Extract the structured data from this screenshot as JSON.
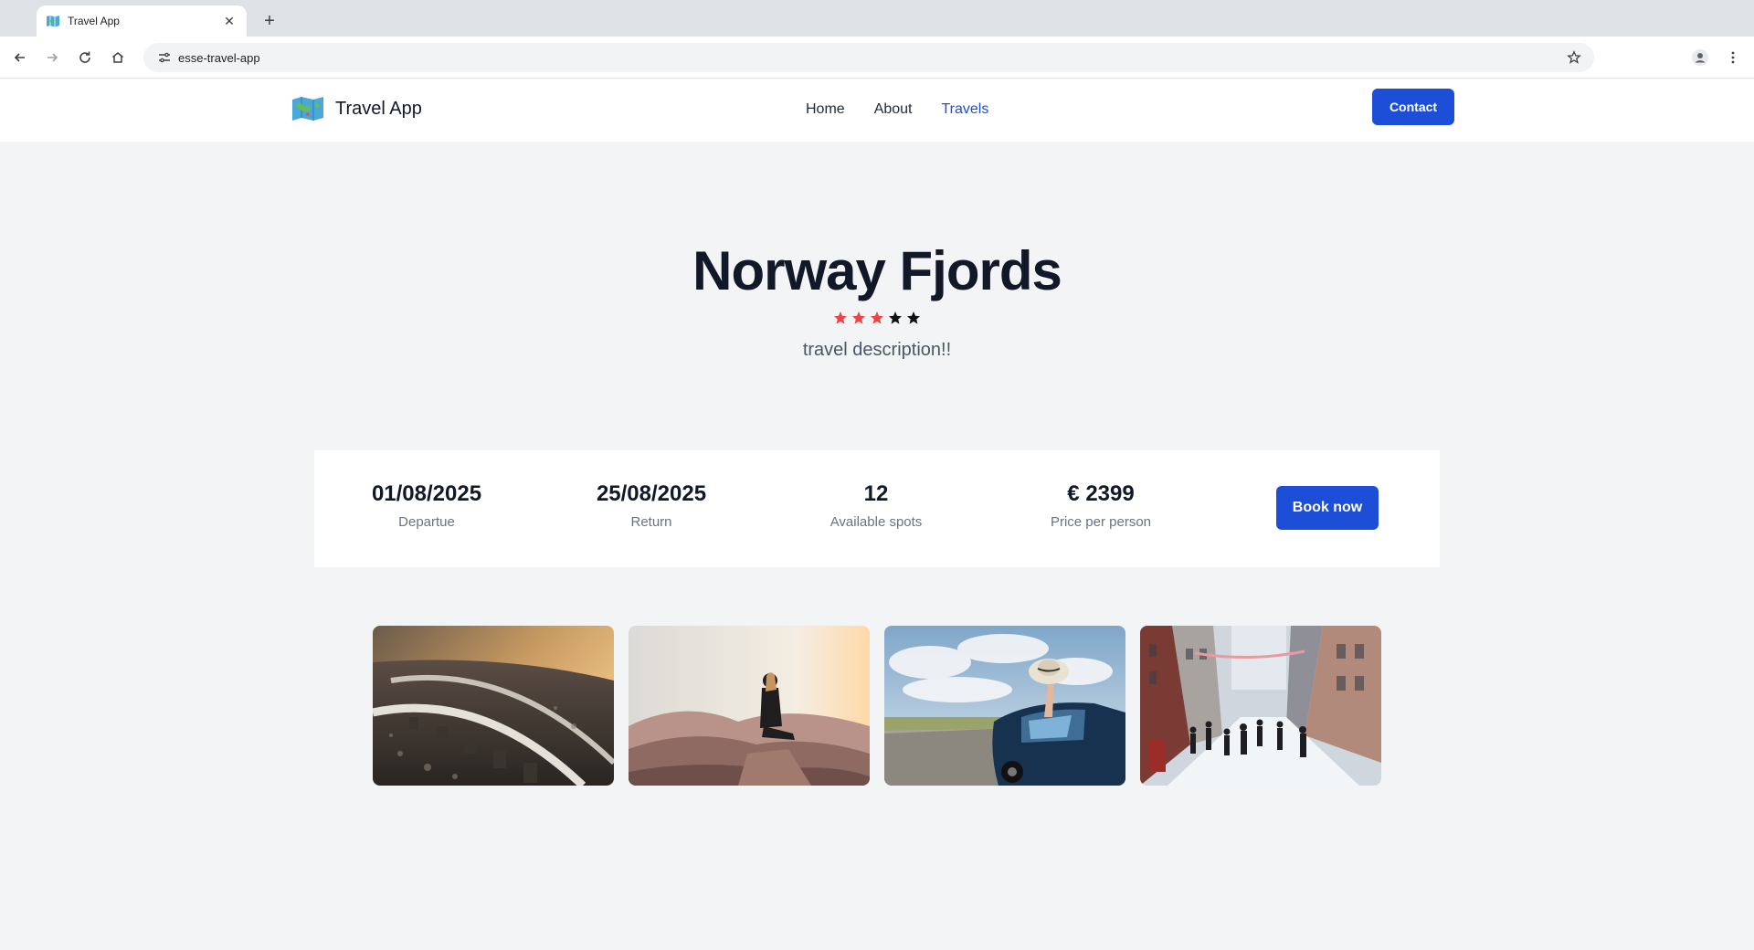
{
  "browser": {
    "tab": {
      "title": "Travel App",
      "favicon": "map-icon",
      "close_icon": "close-icon"
    },
    "new_tab_icon": "plus-icon",
    "toolbar": {
      "back_icon": "arrow-left-icon",
      "forward_icon": "arrow-right-icon",
      "reload_icon": "reload-icon",
      "home_icon": "home-icon",
      "site_info_icon": "tune-icon",
      "url": "esse-travel-app",
      "bookmark_icon": "star-outline-icon",
      "profile_icon": "account-icon",
      "menu_icon": "kebab-menu-icon"
    }
  },
  "header": {
    "brand": {
      "name": "Travel App",
      "logo_icon": "map-icon"
    },
    "nav": [
      {
        "label": "Home",
        "active": false
      },
      {
        "label": "About",
        "active": false
      },
      {
        "label": "Travels",
        "active": true
      }
    ],
    "contact_label": "Contact",
    "accent_color": "#1d4ed8"
  },
  "travel": {
    "title": "Norway Fjords",
    "rating": {
      "value": 3,
      "max": 5,
      "filled_color": "#ef4444",
      "empty_color": "#111111"
    },
    "description": "travel description!!",
    "details": [
      {
        "value": "01/08/2025",
        "label": "Departue"
      },
      {
        "value": "25/08/2025",
        "label": "Return"
      },
      {
        "value": "12",
        "label": "Available spots"
      },
      {
        "value": "€ 2399",
        "label": "Price per person"
      }
    ],
    "book_label": "Book now"
  },
  "gallery": {
    "photos": [
      {
        "subject": "railway-track-photo"
      },
      {
        "subject": "mountain-hiker-photo"
      },
      {
        "subject": "car-hat-photo"
      },
      {
        "subject": "snowy-street-photo"
      }
    ]
  }
}
